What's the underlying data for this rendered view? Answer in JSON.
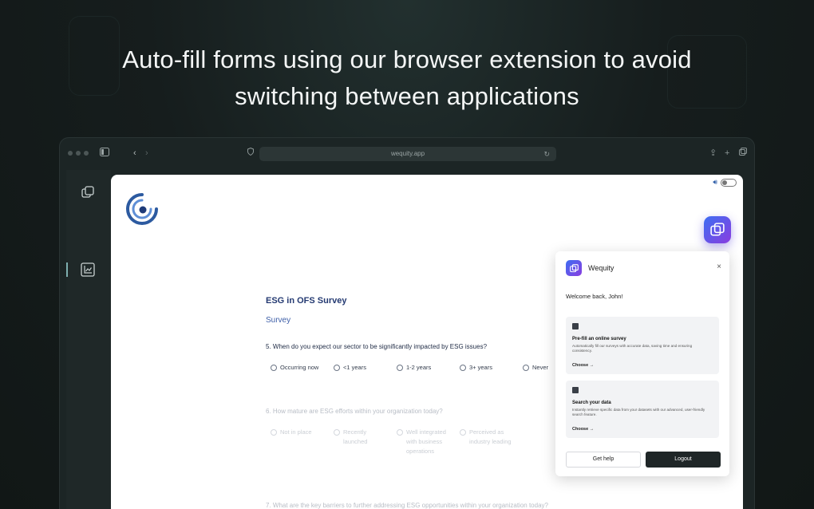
{
  "headline": {
    "line1": "Auto-fill forms using our browser extension to avoid",
    "line2": "switching between applications"
  },
  "browser": {
    "url": "wequity.app",
    "icons": [
      "window-dots-icon",
      "sidebar-toggle-icon",
      "back-icon",
      "forward-icon",
      "shield-icon",
      "reload-icon",
      "share-icon",
      "new-tab-icon",
      "tabs-icon"
    ]
  },
  "sidebar": {
    "items": [
      {
        "icon": "copy-stack-icon"
      },
      {
        "icon": "chart-icon",
        "active": true
      }
    ]
  },
  "survey": {
    "title": "ESG in OFS Survey",
    "subtitle": "Survey",
    "questions": [
      {
        "text": "5. When do you expect our sector to be significantly impacted by ESG issues?",
        "options": [
          "Occurring now",
          "<1 years",
          "1-2 years",
          "3+ years",
          "Never"
        ]
      },
      {
        "text": "6. How mature are ESG efforts within your organization today?",
        "options": [
          "Not in place",
          "Recently launched",
          "Well integrated with business operations",
          "Perceived as industry leading"
        ]
      },
      {
        "text": "7. What are the key barriers to further addressing ESG opportunities within your organization today?",
        "options": []
      }
    ]
  },
  "extension": {
    "name": "Wequity",
    "close": "×",
    "welcome": "Welcome back, John!",
    "cards": [
      {
        "title": "Pre-fill an online survey",
        "description": "Automatically fill our surveys with accurate data, saving time and ensuring consistency.",
        "link": "Choose →"
      },
      {
        "title": "Search your data",
        "description": "Instantly retrieve specific data from your datasets with our advanced, user-friendly search feature.",
        "link": "Choose →"
      }
    ],
    "help_label": "Get help",
    "logout_label": "Logout"
  },
  "colors": {
    "accent_gradient_start": "#3d6ef2",
    "accent_gradient_end": "#8a3de0",
    "background": "#161d1d",
    "survey_title": "#243a72"
  }
}
